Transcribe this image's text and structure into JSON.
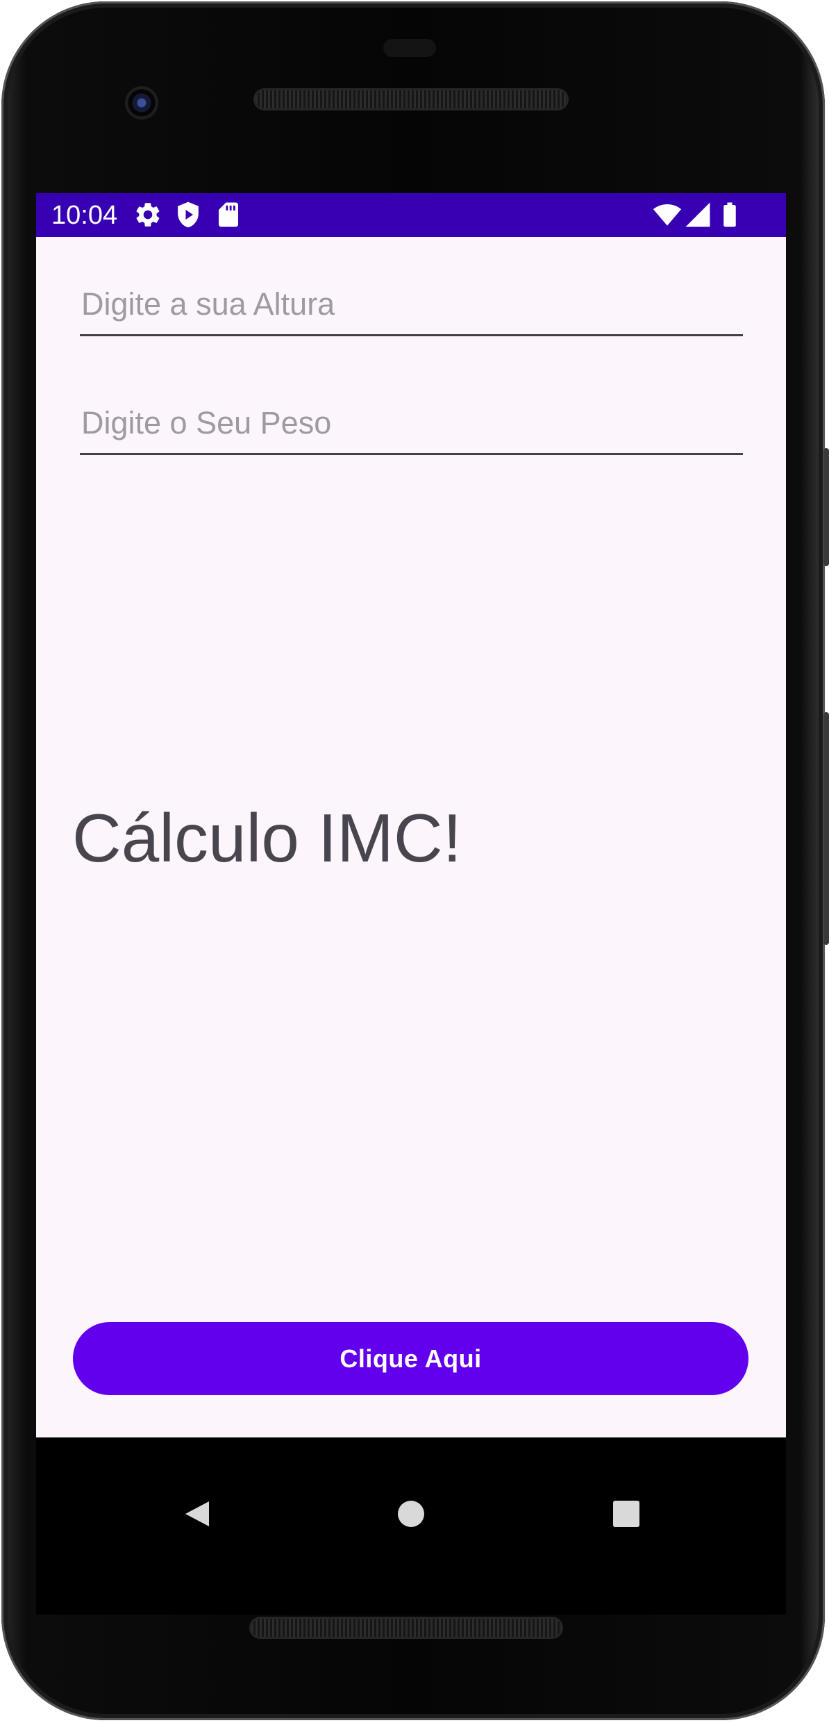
{
  "status_bar": {
    "time": "10:04",
    "left_icons": [
      "settings-gear-icon",
      "shield-play-icon",
      "sd-card-icon"
    ],
    "right_icons": [
      "wifi-icon",
      "cell-signal-icon",
      "battery-icon"
    ],
    "background_color": "#3700b3"
  },
  "form": {
    "height_placeholder": "Digite a sua Altura",
    "height_value": "",
    "weight_placeholder": "Digite o Seu Peso",
    "weight_value": ""
  },
  "main": {
    "title": "Cálculo IMC!"
  },
  "action": {
    "button_label": "Clique Aqui",
    "button_color": "#6200ee"
  },
  "nav_bar": {
    "buttons": [
      "back-icon",
      "home-icon",
      "recents-icon"
    ]
  },
  "colors": {
    "app_background": "#fcf5fc",
    "title_text": "#49454f",
    "hint_text": "#9e9aa0"
  }
}
